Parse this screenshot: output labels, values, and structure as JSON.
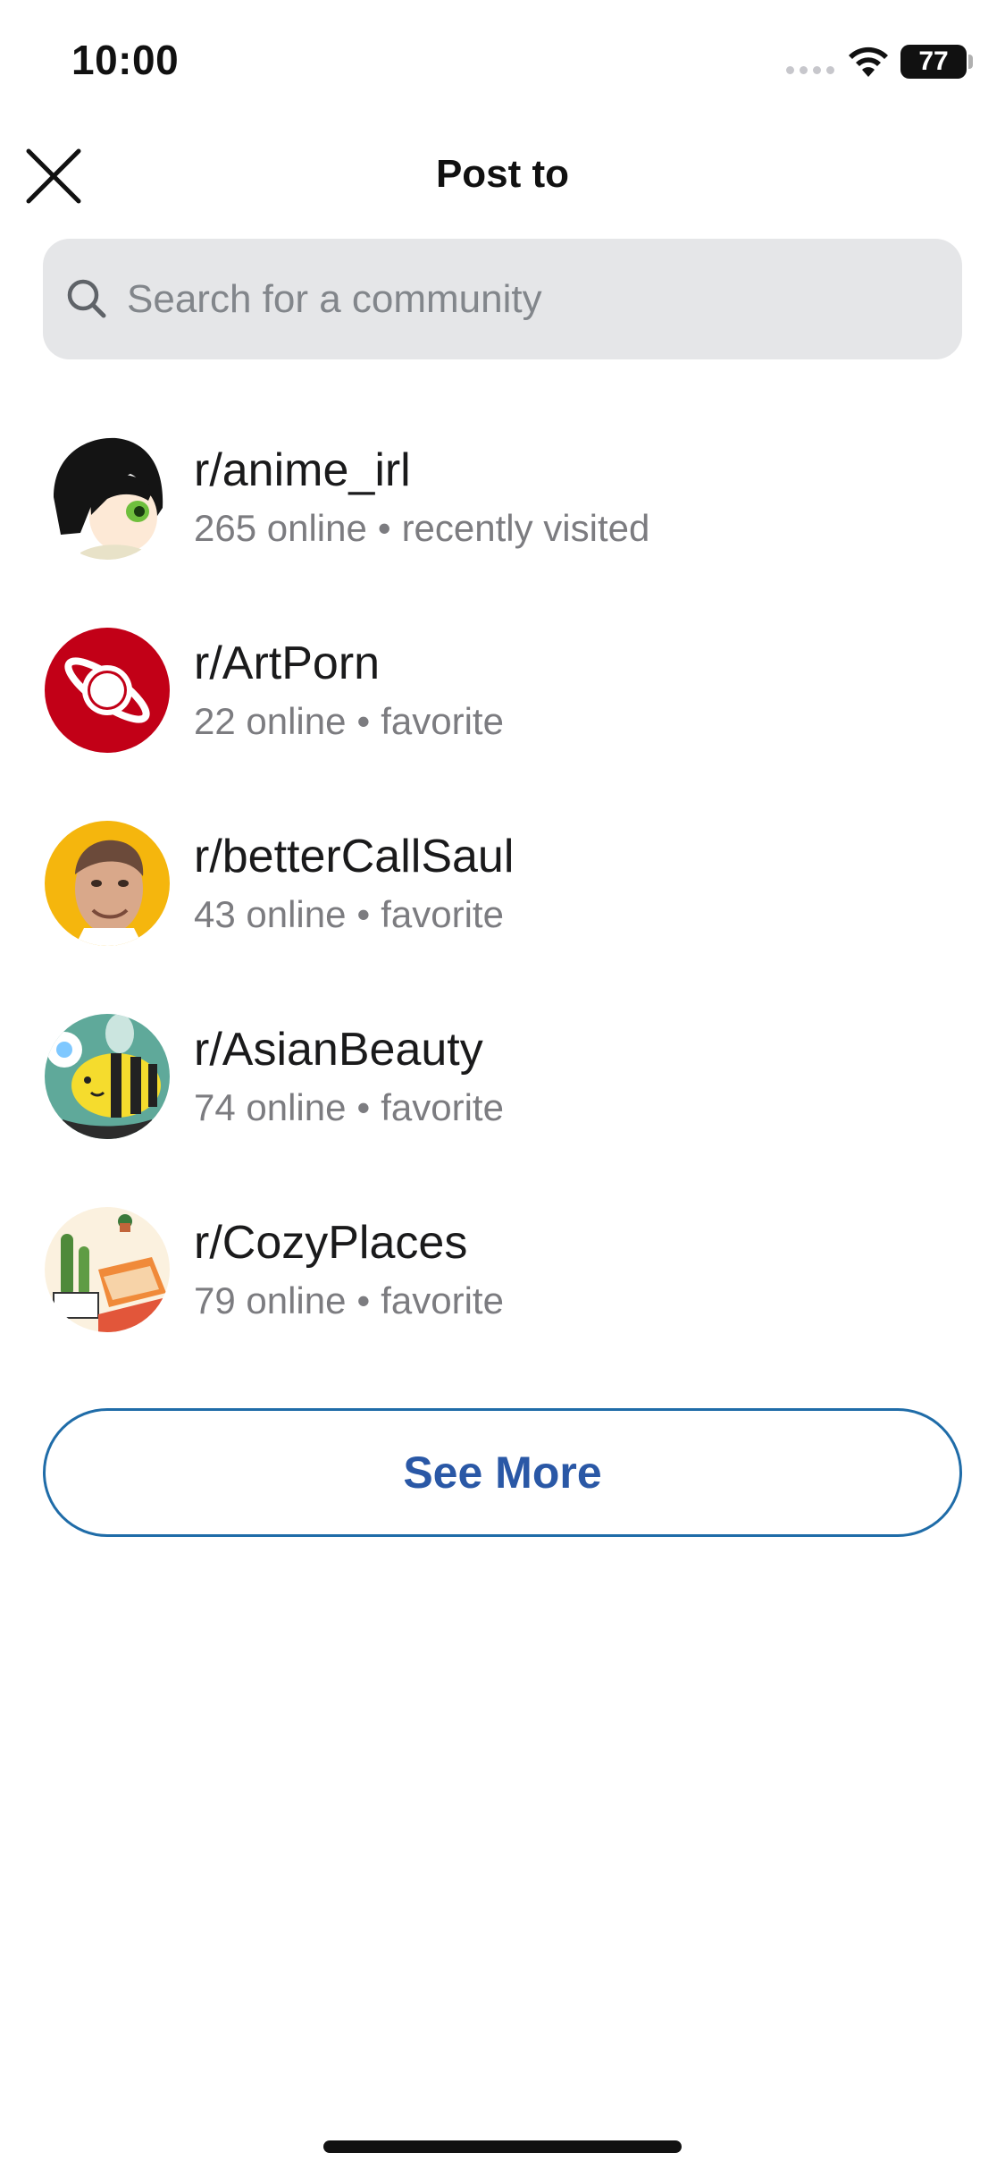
{
  "status_bar": {
    "time": "10:00",
    "battery_level": "77",
    "icons": [
      "cellular-signal-icon",
      "wifi-icon",
      "battery-icon"
    ]
  },
  "header": {
    "title": "Post to",
    "close_icon": "close-icon"
  },
  "search": {
    "placeholder": "Search for a community",
    "value": "",
    "icon": "search-icon"
  },
  "communities": [
    {
      "name": "r/anime_irl",
      "online": "265 online",
      "tag": "recently visited",
      "avatar": "anime-girl-avatar"
    },
    {
      "name": "r/ArtPorn",
      "online": "22 online",
      "tag": "favorite",
      "avatar": "planet-avatar",
      "avatar_color": "#c20017"
    },
    {
      "name": "r/betterCallSaul",
      "online": "43 online",
      "tag": "favorite",
      "avatar": "saul-face-avatar",
      "avatar_color": "#f5b60d"
    },
    {
      "name": "r/AsianBeauty",
      "online": "74 online",
      "tag": "favorite",
      "avatar": "bee-avatar",
      "avatar_color": "#5fa99a"
    },
    {
      "name": "r/CozyPlaces",
      "online": "79 online",
      "tag": "favorite",
      "avatar": "cozy-room-avatar"
    }
  ],
  "separator": "•",
  "see_more": {
    "label": "See More",
    "color": "#2a58a6",
    "border_color": "#1f6ca8"
  }
}
